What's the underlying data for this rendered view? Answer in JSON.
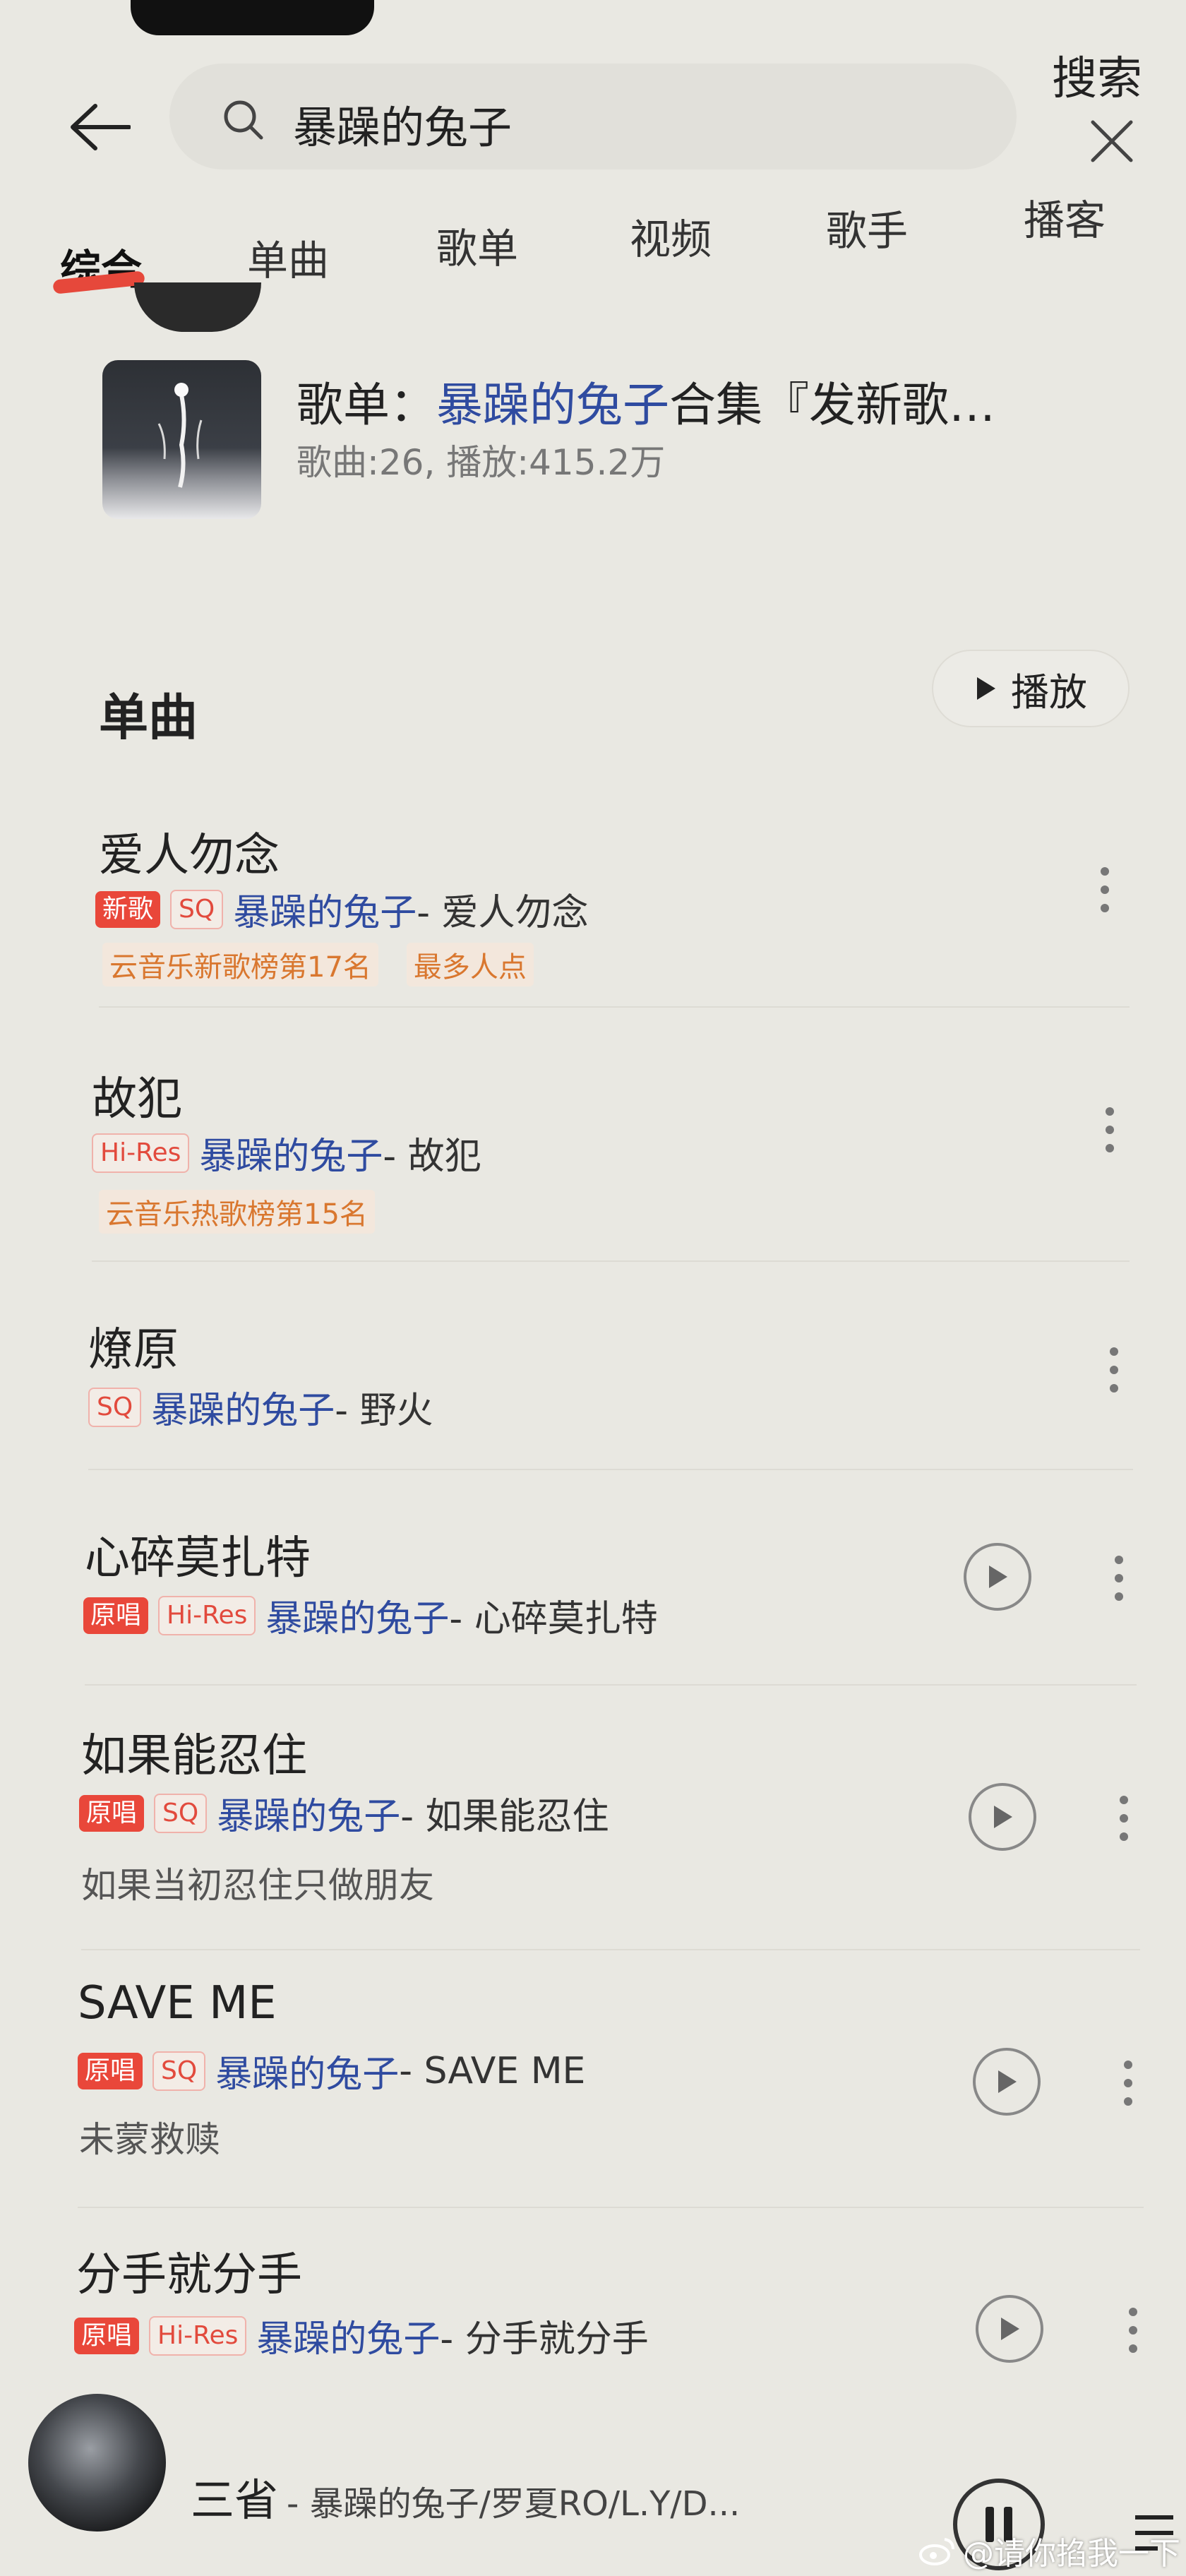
{
  "search": {
    "query": "暴躁的兔子",
    "submit_label": "搜索"
  },
  "tabs": [
    {
      "label": "综合",
      "active": true
    },
    {
      "label": "单曲",
      "active": false
    },
    {
      "label": "歌单",
      "active": false
    },
    {
      "label": "视频",
      "active": false
    },
    {
      "label": "歌手",
      "active": false
    },
    {
      "label": "播客",
      "active": false
    }
  ],
  "playlist": {
    "prefix": "歌单：",
    "highlight": "暴躁的兔子",
    "suffix": "合集『发新歌…",
    "meta": "歌曲:26, 播放:415.2万"
  },
  "singles": {
    "title": "单曲",
    "play_all_label": "播放",
    "songs": [
      {
        "title": "爱人勿念",
        "badges": [
          "新歌",
          "SQ"
        ],
        "artist": "暴躁的兔子",
        "song": " - 爱人勿念",
        "tags": [
          "云音乐新歌榜第17名",
          "最多人点"
        ]
      },
      {
        "title": "故犯",
        "badges": [
          "Hi-Res"
        ],
        "artist": "暴躁的兔子",
        "song": " - 故犯",
        "tags": [
          "云音乐热歌榜第15名"
        ]
      },
      {
        "title": "燎原",
        "badges": [
          "SQ"
        ],
        "artist": "暴躁的兔子",
        "song": " - 野火"
      },
      {
        "title": "心碎莫扎特",
        "badges": [
          "原唱",
          "Hi-Res"
        ],
        "artist": "暴躁的兔子",
        "song": " - 心碎莫扎特"
      },
      {
        "title": "如果能忍住",
        "badges": [
          "原唱",
          "SQ"
        ],
        "artist": "暴躁的兔子",
        "song": " - 如果能忍住",
        "desc": "如果当初忍住只做朋友"
      },
      {
        "title": "SAVE ME",
        "badges": [
          "原唱",
          "SQ"
        ],
        "artist": "暴躁的兔子",
        "song": " - SAVE ME",
        "desc": "未蒙救赎"
      },
      {
        "title": "分手就分手",
        "badges": [
          "原唱",
          "Hi-Res"
        ],
        "artist": "暴躁的兔子",
        "song": " - 分手就分手"
      }
    ]
  },
  "player": {
    "title": "三省",
    "subtitle": "- 暴躁的兔子/罗夏RO/L.Y/D..."
  },
  "watermark": "@请你掐我一下",
  "colors": {
    "accent_red": "#e9473a",
    "link_blue": "#2f4ba0",
    "tag_orange": "#d9772f"
  }
}
